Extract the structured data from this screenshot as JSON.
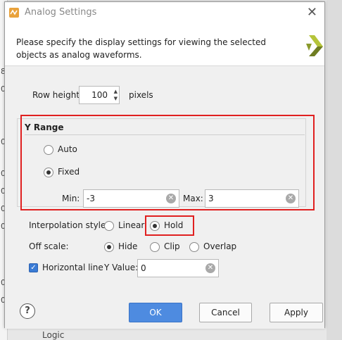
{
  "window": {
    "title": "Analog Settings"
  },
  "description": "Please specify the display settings for viewing the selected objects as analog waveforms.",
  "row_height": {
    "label": "Row height:",
    "value": "100",
    "unit": "pixels"
  },
  "y_range": {
    "title": "Y Range",
    "auto_label": "Auto",
    "fixed_label": "Fixed",
    "selected": "Fixed",
    "min_label": "Min:",
    "min_value": "-3",
    "max_label": "Max:",
    "max_value": "3"
  },
  "interpolation": {
    "label": "Interpolation style:",
    "linear_label": "Linear",
    "hold_label": "Hold",
    "selected": "Hold"
  },
  "off_scale": {
    "label": "Off scale:",
    "hide_label": "Hide",
    "clip_label": "Clip",
    "overlap_label": "Overlap",
    "selected": "Hide"
  },
  "horizontal_line": {
    "label": "Horizontal line",
    "checked": true,
    "y_value_label": "Y Value:",
    "y_value": "0"
  },
  "buttons": {
    "help": "?",
    "ok": "OK",
    "cancel": "Cancel",
    "apply": "Apply"
  },
  "background": {
    "left_glyphs": [
      "8",
      "0",
      "0",
      "0",
      "0",
      "0",
      "0",
      "0",
      "0"
    ],
    "bottom_text": "Logic"
  },
  "colors": {
    "accent": "#4e8be0",
    "highlight": "#e02020"
  }
}
